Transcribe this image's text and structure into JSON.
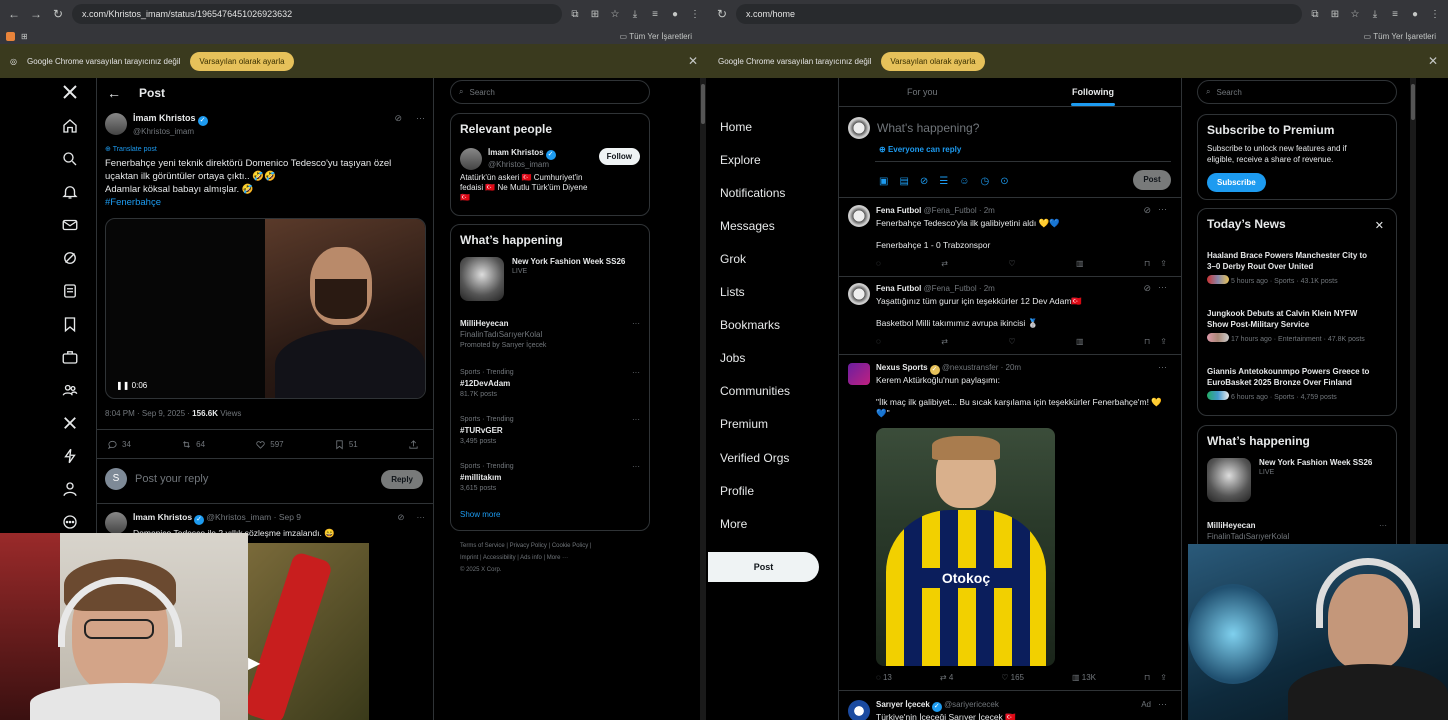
{
  "left": {
    "url": "x.com/Khristos_imam/status/1965476451026923632",
    "bookmarks": "Tüm Yer İşaretleri",
    "infobar": {
      "text": "Google Chrome varsayılan tarayıcınız değil",
      "button": "Varsayılan olarak ayarla"
    },
    "header": {
      "title": "Post"
    },
    "tweet": {
      "name": "İmam Khristos",
      "handle": "@Khristos_imam",
      "translate": "Translate post",
      "line1": "Fenerbahçe yeni teknik direktörü Domenico Tedesco'yu taşıyan özel",
      "line2": "uçaktan ilk görüntüler ortaya çıktı.. 🤣🤣",
      "line3": "Adamlar köksal babayı almışlar. 🤣",
      "hashtag": "#Fenerbahçe",
      "video_time": "0:06",
      "meta_time": "8:04 PM · Sep 9, 2025 · ",
      "views_count": "156.6K",
      "views_label": " Views",
      "replies": "34",
      "retweets": "64",
      "likes": "597",
      "bookmarks": "51"
    },
    "reply_box": {
      "avatar_letter": "S",
      "placeholder": "Post your reply",
      "button": "Reply"
    },
    "second_tweet": {
      "name": "İmam Khristos",
      "handle": "@Khristos_imam · Sep 9",
      "text": "Domenico Tedesco ile 2 yıllık sözleşme imzalandı. 😄"
    },
    "search_placeholder": "Search",
    "relevant": {
      "title": "Relevant people",
      "name": "İmam Khristos",
      "handle": "@Khristos_imam",
      "follow": "Follow",
      "bio1": "Atatürk'ün askeri 🇹🇷 Cumhuriyet'in",
      "bio2": "fedaisi 🇹🇷 Ne Mutlu Türk'üm Diyene",
      "bio3": "🇹🇷"
    },
    "happening": {
      "title": "What’s happening",
      "event_title": "New York Fashion Week SS26",
      "event_status": "LIVE",
      "promo_name": "MilliHeyecan",
      "promo_sub": "FinalinTadıSarıyerKolal",
      "promo_by": "Promoted by Sarıyer İçecek",
      "trends": [
        {
          "cat": "Sports · Trending",
          "tag": "#12DevAdam",
          "count": "81.7K posts"
        },
        {
          "cat": "Sports · Trending",
          "tag": "#TURvGER",
          "count": "3,495 posts"
        },
        {
          "cat": "Sports · Trending",
          "tag": "#millitakım",
          "count": "3,615 posts"
        }
      ],
      "show_more": "Show more"
    },
    "footer": {
      "l1": [
        "Terms of Service",
        "Privacy Policy",
        "Cookie Policy"
      ],
      "l2": [
        "Imprint",
        "Accessibility",
        "Ads info",
        "More ···"
      ],
      "copy": "© 2025 X Corp."
    }
  },
  "right": {
    "url": "x.com/home",
    "bookmarks": "Tüm Yer İşaretleri",
    "infobar": {
      "text": "Google Chrome varsayılan tarayıcınız değil",
      "button": "Varsayılan olarak ayarla"
    },
    "nav": [
      "Home",
      "Explore",
      "Notifications",
      "Messages",
      "Grok",
      "Lists",
      "Bookmarks",
      "Jobs",
      "Communities",
      "Premium",
      "Verified Orgs",
      "Profile",
      "More"
    ],
    "post_button": "Post",
    "tabs": {
      "for_you": "For you",
      "following": "Following"
    },
    "compose": {
      "placeholder": "What's happening?",
      "everyone": "Everyone can reply",
      "button": "Post"
    },
    "tweets": [
      {
        "name": "Fena Futbol",
        "handle": "@Fena_Futbol · 2m",
        "line1": "Fenerbahçe Tedesco'yla ilk galibiyetini aldı 💛💙",
        "line2": "",
        "line3": "Fenerbahçe 1 - 0 Trabzonspor"
      },
      {
        "name": "Fena Futbol",
        "handle": "@Fena_Futbol · 2m",
        "line1": "Yaşattığınız tüm gurur için teşekkürler 12 Dev Adam🇹🇷",
        "line2": "",
        "line3": "Basketbol Milli takımımız avrupa ikincisi 🥈"
      }
    ],
    "nexus": {
      "name": "Nexus Sports",
      "handle": "@nexustransfer · 20m",
      "line1": "Kerem Aktürkoğlu'nun paylaşımı:",
      "line2": "\"İlk maç ilk galibiyet... Bu sıcak karşılama için teşekkürler Fenerbahçe'm! 💛",
      "line3": "💙\"",
      "replies": "13",
      "retweets": "4",
      "likes": "165",
      "views": "13K",
      "jersey_sponsor": "Otokoç"
    },
    "ad_tweet": {
      "name": "Sarıyer İçecek",
      "handle": "@sariyericecek",
      "ad": "Ad",
      "text": "Türkiye'nin İçeceği Sarıyer İçecek 🇹🇷"
    },
    "search_placeholder": "Search",
    "premium": {
      "title": "Subscribe to Premium",
      "desc1": "Subscribe to unlock new features and if",
      "desc2": "eligible, receive a share of revenue.",
      "button": "Subscribe"
    },
    "news": {
      "title": "Today’s News",
      "items": [
        {
          "headline1": "Haaland Brace Powers Manchester City to",
          "headline2": "3–0 Derby Rout Over United",
          "meta": "5 hours ago · Sports · 43.1K posts"
        },
        {
          "headline1": "Jungkook Debuts at Calvin Klein NYFW",
          "headline2": "Show Post-Military Service",
          "meta": "17 hours ago · Entertainment · 47.8K posts"
        },
        {
          "headline1": "Giannis Antetokounmpo Powers Greece to",
          "headline2": "EuroBasket 2025 Bronze Over Finland",
          "meta": "6 hours ago · Sports · 4,759 posts"
        }
      ]
    },
    "happening": {
      "title": "What’s happening",
      "event_title": "New York Fashion Week SS26",
      "event_status": "LIVE",
      "promo_name": "MilliHeyecan",
      "promo_sub": "FinalinTadıSarıyerKolal"
    }
  },
  "colors": {
    "accent": "#1d9bf0",
    "bg": "#000000",
    "border": "#2f3336",
    "muted": "#71767b",
    "infobar": "#3a3a1e",
    "chip": "#e6c15a"
  }
}
